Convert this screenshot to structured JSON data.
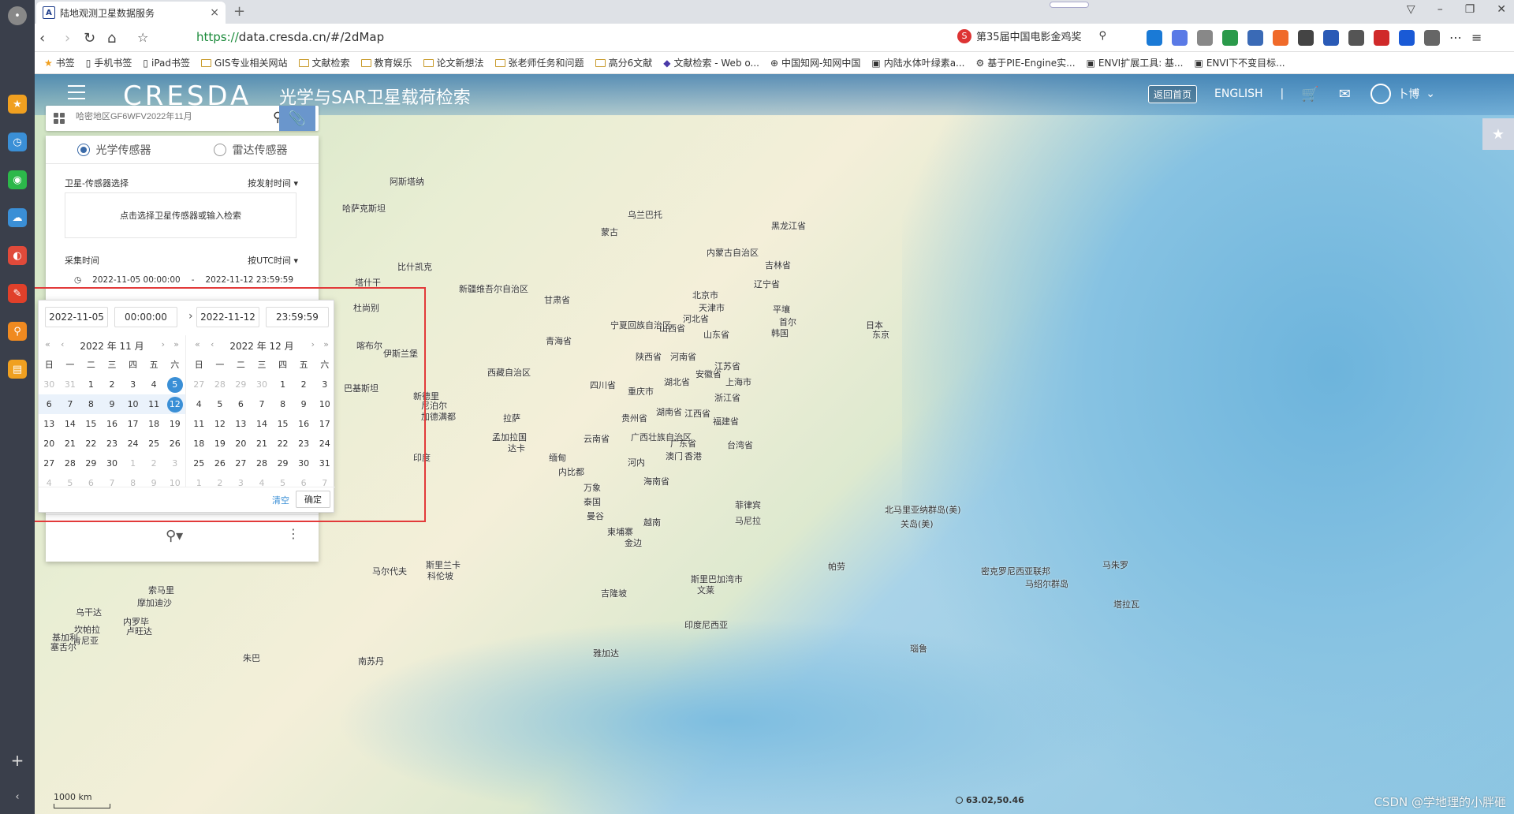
{
  "browser": {
    "tab_title": "陆地观测卫星数据服务",
    "url_scheme": "https://",
    "url_rest": "data.cresda.cn/#/2dMap",
    "search_suggest": "第35届中国电影金鸡奖",
    "bookmarks": [
      "书签",
      "手机书签",
      "iPad书签",
      "GIS专业相关网站",
      "文献检索",
      "教育娱乐",
      "论文新想法",
      "张老师任务和问题",
      "高分6文献",
      "文献检索 - Web o...",
      "中国知网-知网中国",
      "内陆水体叶绿素a...",
      "基于PIE-Engine实...",
      "ENVI扩展工具: 基...",
      "ENVI下不变目标..."
    ]
  },
  "header": {
    "logo": "CRESDA",
    "title": "光学与SAR卫星载荷检索",
    "home_button": "返回首页",
    "english": "ENGLISH",
    "separator": "|",
    "username": "卜博"
  },
  "search": {
    "placeholder": "哈密地区GF6WFV2022年11月"
  },
  "panel": {
    "tab_optical": "光学传感器",
    "tab_radar": "雷达传感器",
    "sat_label": "卫星-传感器选择",
    "sat_sort": "按发射时间 ▾",
    "sat_placeholder": "点击选择卫星传感器或输入检索",
    "time_label": "采集时间",
    "time_sort": "按UTC时间 ▾",
    "start": "2022-11-05 00:00:00",
    "dash": "-",
    "end": "2022-11-12 23:59:59"
  },
  "picker": {
    "start_date": "2022-11-05",
    "start_time": "00:00:00",
    "end_date": "2022-11-12",
    "end_time": "23:59:59",
    "left_month": "2022 年 11 月",
    "right_month": "2022 年 12 月",
    "weekdays": [
      "日",
      "一",
      "二",
      "三",
      "四",
      "五",
      "六"
    ],
    "left_rows": [
      [
        "30",
        "31",
        "1",
        "2",
        "3",
        "4",
        "5"
      ],
      [
        "6",
        "7",
        "8",
        "9",
        "10",
        "11",
        "12"
      ],
      [
        "13",
        "14",
        "15",
        "16",
        "17",
        "18",
        "19"
      ],
      [
        "20",
        "21",
        "22",
        "23",
        "24",
        "25",
        "26"
      ],
      [
        "27",
        "28",
        "29",
        "30",
        "1",
        "2",
        "3"
      ],
      [
        "4",
        "5",
        "6",
        "7",
        "8",
        "9",
        "10"
      ]
    ],
    "right_rows": [
      [
        "27",
        "28",
        "29",
        "30",
        "1",
        "2",
        "3"
      ],
      [
        "4",
        "5",
        "6",
        "7",
        "8",
        "9",
        "10"
      ],
      [
        "11",
        "12",
        "13",
        "14",
        "15",
        "16",
        "17"
      ],
      [
        "18",
        "19",
        "20",
        "21",
        "22",
        "23",
        "24"
      ],
      [
        "25",
        "26",
        "27",
        "28",
        "29",
        "30",
        "31"
      ],
      [
        "1",
        "2",
        "3",
        "4",
        "5",
        "6",
        "7"
      ]
    ],
    "clear": "清空",
    "confirm": "确定"
  },
  "map": {
    "labels": [
      {
        "t": "阿斯塔纳"
      },
      {
        "t": "哈萨克斯坦"
      },
      {
        "t": "乌兰巴托"
      },
      {
        "t": "蒙古"
      },
      {
        "t": "黑龙江省"
      },
      {
        "t": "内蒙古自治区"
      },
      {
        "t": "吉林省"
      },
      {
        "t": "辽宁省"
      },
      {
        "t": "比什凯克"
      },
      {
        "t": "塔什干"
      },
      {
        "t": "杜尚别"
      },
      {
        "t": "新疆维吾尔自治区"
      },
      {
        "t": "甘肃省"
      },
      {
        "t": "北京市"
      },
      {
        "t": "天津市"
      },
      {
        "t": "河北省"
      },
      {
        "t": "平壤"
      },
      {
        "t": "首尔"
      },
      {
        "t": "韩国"
      },
      {
        "t": "日本"
      },
      {
        "t": "东京"
      },
      {
        "t": "喀布尔"
      },
      {
        "t": "伊斯兰堡"
      },
      {
        "t": "宁夏回族自治区"
      },
      {
        "t": "山西省"
      },
      {
        "t": "山东省"
      },
      {
        "t": "青海省"
      },
      {
        "t": "陕西省"
      },
      {
        "t": "河南省"
      },
      {
        "t": "江苏省"
      },
      {
        "t": "西藏自治区"
      },
      {
        "t": "安徽省"
      },
      {
        "t": "巴基斯坦"
      },
      {
        "t": "四川省"
      },
      {
        "t": "湖北省"
      },
      {
        "t": "上海市"
      },
      {
        "t": "新德里"
      },
      {
        "t": "重庆市"
      },
      {
        "t": "浙江省"
      },
      {
        "t": "尼泊尔"
      },
      {
        "t": "加德满都"
      },
      {
        "t": "拉萨"
      },
      {
        "t": "贵州省"
      },
      {
        "t": "湖南省"
      },
      {
        "t": "江西省"
      },
      {
        "t": "福建省"
      },
      {
        "t": "孟加拉国"
      },
      {
        "t": "达卡"
      },
      {
        "t": "云南省"
      },
      {
        "t": "广西壮族自治区"
      },
      {
        "t": "广东省"
      },
      {
        "t": "台湾省"
      },
      {
        "t": "印度"
      },
      {
        "t": "缅甸"
      },
      {
        "t": "澳门"
      },
      {
        "t": "香港"
      },
      {
        "t": "河内"
      },
      {
        "t": "内比都"
      },
      {
        "t": "海南省"
      },
      {
        "t": "万象"
      },
      {
        "t": "泰国"
      },
      {
        "t": "曼谷"
      },
      {
        "t": "菲律宾"
      },
      {
        "t": "马尼拉"
      },
      {
        "t": "柬埔寨"
      },
      {
        "t": "金边"
      },
      {
        "t": "越南"
      },
      {
        "t": "北马里亚纳群岛(美)"
      },
      {
        "t": "关岛(美)"
      },
      {
        "t": "马尔代夫"
      },
      {
        "t": "斯里兰卡"
      },
      {
        "t": "科伦坡"
      },
      {
        "t": "斯里巴加湾市"
      },
      {
        "t": "文莱"
      },
      {
        "t": "帕劳"
      },
      {
        "t": "密克罗尼西亚联邦"
      },
      {
        "t": "马绍尔群岛"
      },
      {
        "t": "马朱罗"
      },
      {
        "t": "吉隆坡"
      },
      {
        "t": "印度尼西亚"
      },
      {
        "t": "塔拉瓦"
      },
      {
        "t": "瑙鲁"
      },
      {
        "t": "雅加达"
      },
      {
        "t": "索马里"
      },
      {
        "t": "摩加迪沙"
      },
      {
        "t": "乌干达"
      },
      {
        "t": "坎帕拉"
      },
      {
        "t": "肯尼亚"
      },
      {
        "t": "内罗毕"
      },
      {
        "t": "卢旺达"
      },
      {
        "t": "基加利"
      },
      {
        "t": "塞舌尔"
      },
      {
        "t": "朱巴"
      },
      {
        "t": "南苏丹"
      },
      {
        "t": "1000 km"
      }
    ]
  },
  "status": {
    "coords": "63.02,50.46",
    "watermark": "CSDN @学地理的小胖砸"
  }
}
